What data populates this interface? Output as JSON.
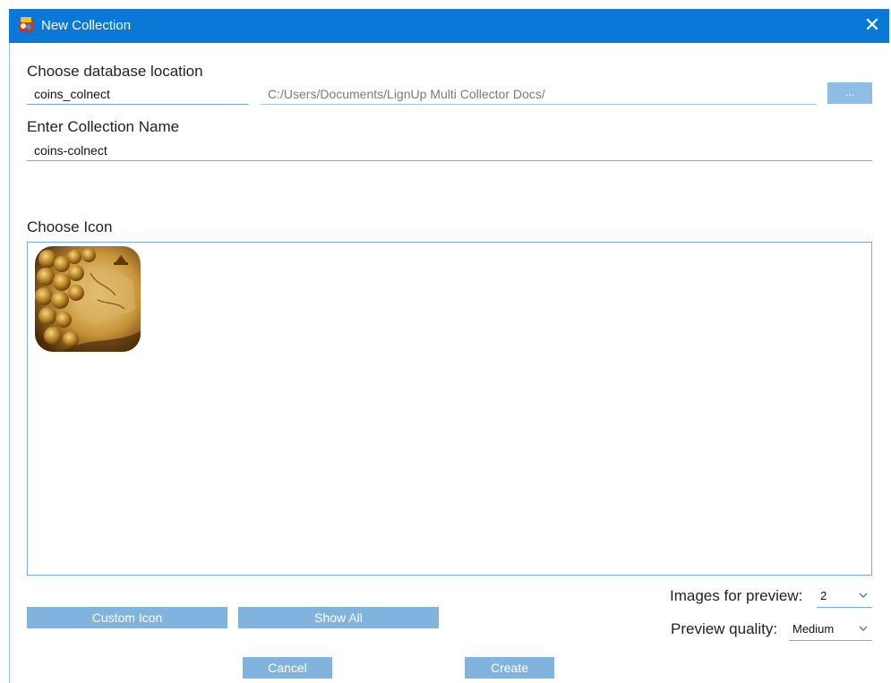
{
  "window": {
    "title": "New Collection",
    "close_glyph": "✕"
  },
  "database": {
    "label": "Choose database location",
    "name_value": "coins_colnect",
    "path_value": "C:/Users/Documents/LignUp Multi Collector Docs/",
    "browse_label": "..."
  },
  "collection": {
    "label": "Enter Collection Name",
    "value": "coins-colnect"
  },
  "icon_section": {
    "label": "Choose Icon",
    "selected_icon": "coins-map-icon"
  },
  "buttons": {
    "custom_icon": "Custom Icon",
    "show_all": "Show All",
    "cancel": "Cancel",
    "create": "Create"
  },
  "preview": {
    "images_label": "Images for preview:",
    "images_value": "2",
    "quality_label": "Preview quality:",
    "quality_value": "Medium"
  },
  "colors": {
    "titlebar": "#0a78d6",
    "button": "#80b4de",
    "field_underline": "#7aaed8"
  }
}
